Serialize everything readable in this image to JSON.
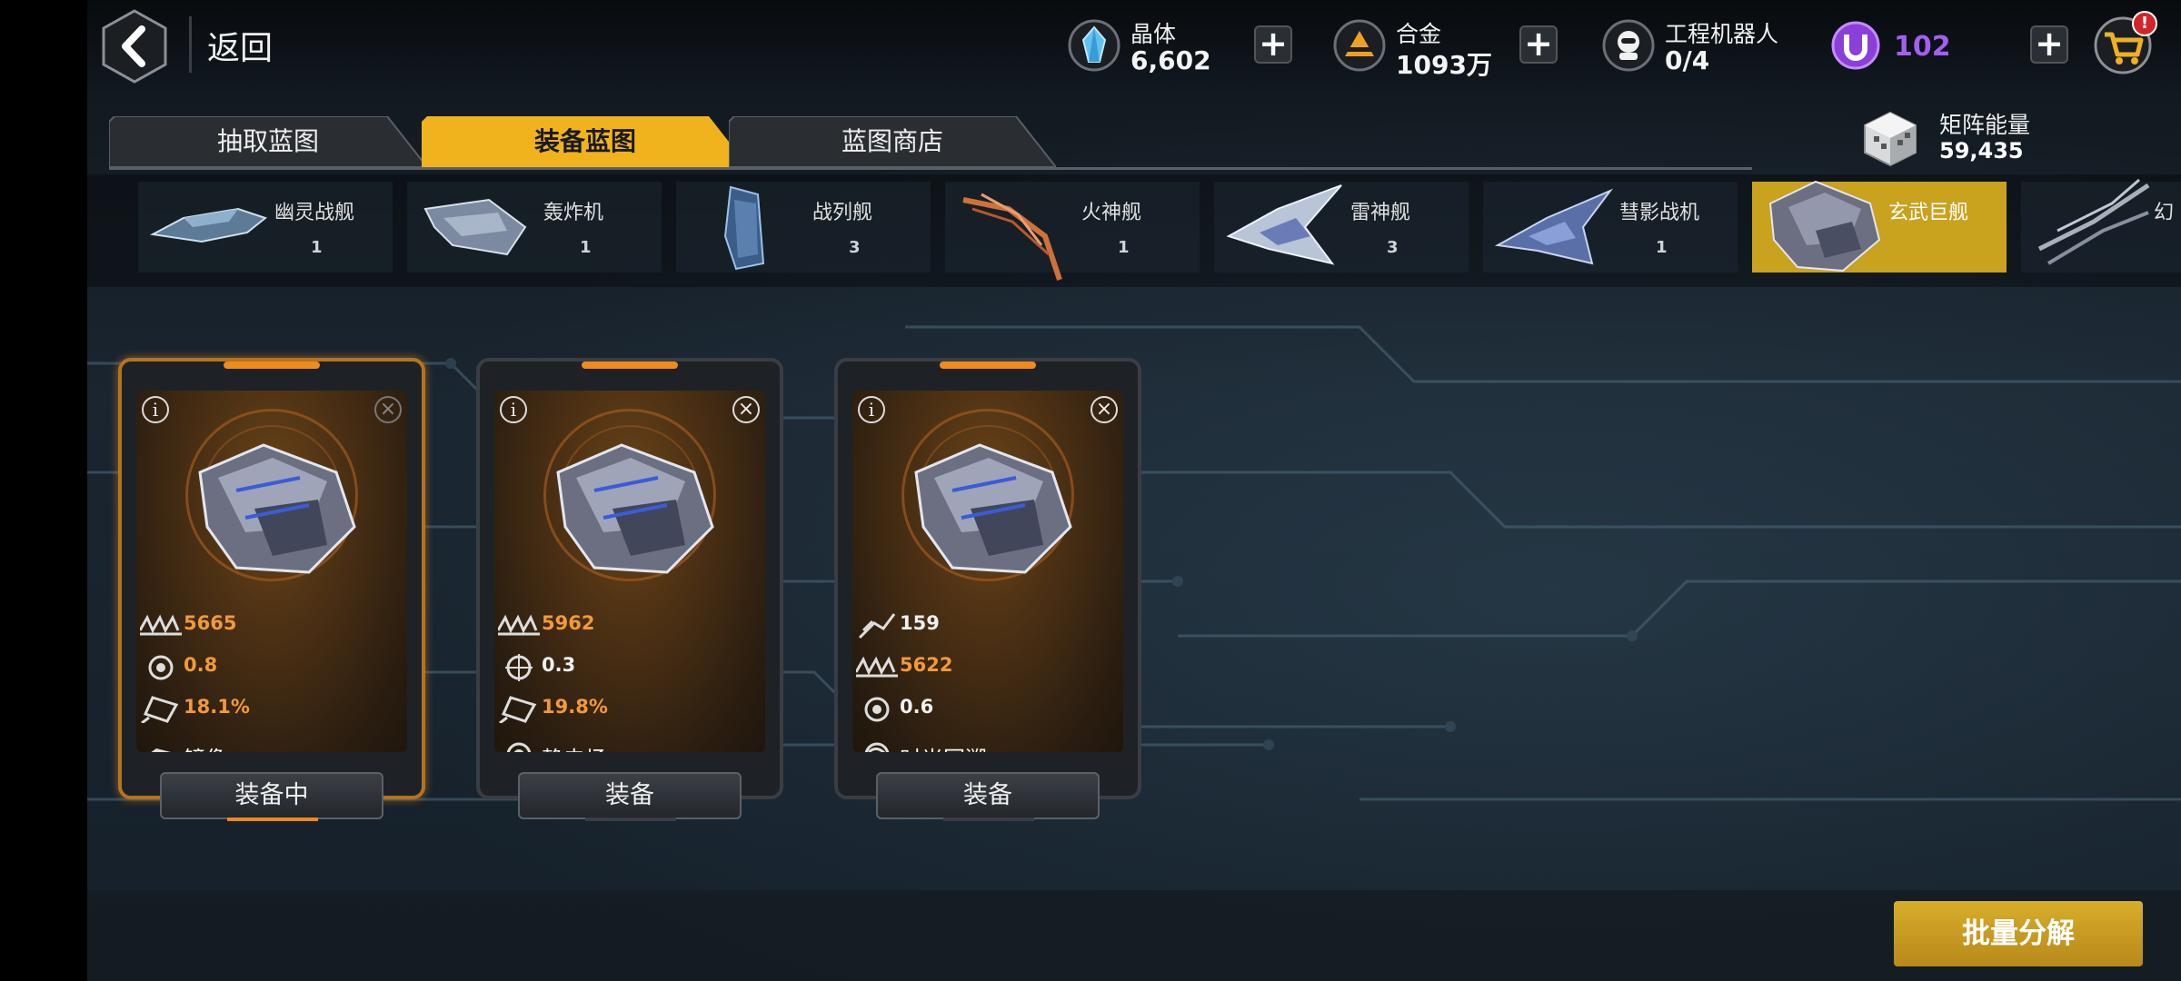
{
  "header": {
    "back_label": "返回"
  },
  "resources": {
    "crystal": {
      "label": "晶体",
      "value": "6,602"
    },
    "alloy": {
      "label": "合金",
      "value": "1093万"
    },
    "robot": {
      "label": "工程机器人",
      "value": "0/4"
    },
    "premium": {
      "value": "102"
    },
    "cart_badge": "!"
  },
  "tabs": [
    {
      "label": "抽取蓝图"
    },
    {
      "label": "装备蓝图"
    },
    {
      "label": "蓝图商店"
    }
  ],
  "matrix": {
    "label": "矩阵能量",
    "value": "59,435"
  },
  "ships": [
    {
      "name": "幽灵战舰",
      "count": "1"
    },
    {
      "name": "轰炸机",
      "count": "1"
    },
    {
      "name": "战列舰",
      "count": "3"
    },
    {
      "name": "火神舰",
      "count": "1"
    },
    {
      "name": "雷神舰",
      "count": "3"
    },
    {
      "name": "彗影战机",
      "count": "1"
    },
    {
      "name": "玄武巨舰",
      "count": ""
    },
    {
      "name": "幻",
      "count": ""
    }
  ],
  "cards": [
    {
      "stats": [
        "5665",
        "0.8",
        "18.1%"
      ],
      "skill": "镜像",
      "button": "装备中"
    },
    {
      "stats": [
        "5962",
        "0.3",
        "19.8%"
      ],
      "skill": "静电场",
      "button": "装备"
    },
    {
      "stats": [
        "159",
        "5622",
        "0.6"
      ],
      "skill": "时光回溯",
      "button": "装备"
    }
  ],
  "batch_button": "批量分解",
  "colors": {
    "accent": "#c9a21e",
    "stat_orange": "#f19a3a",
    "premium": "#8b3fd9"
  }
}
